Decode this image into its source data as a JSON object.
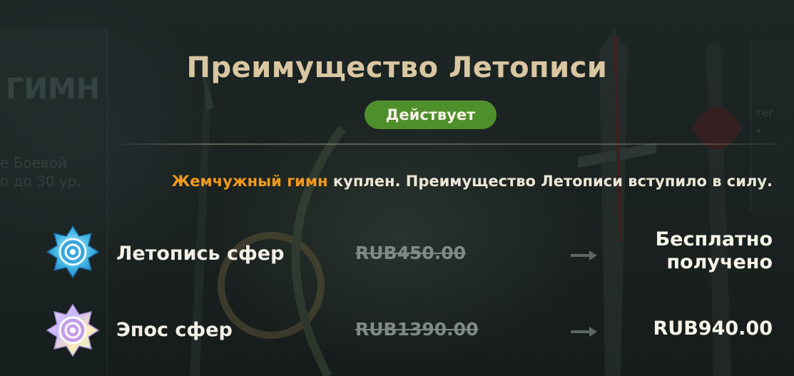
{
  "header": {
    "title": "Преимущество Летописи",
    "status_badge": "Действует"
  },
  "background": {
    "left_panel_title": "ГИМН",
    "left_panel_text_line1": "е Боевой",
    "left_panel_text_line2": "о до 30 ур.",
    "right_panel_text_line1": "тег",
    "right_panel_text_line2": "•"
  },
  "notice": {
    "highlight": "Жемчужный гимн",
    "rest": " куплен. Преимущество Летописи вступило в силу."
  },
  "rows": [
    {
      "name": "Летопись сфер",
      "old_price": "RUB450.00",
      "result_line1": "Бесплатно",
      "result_line2": "получено",
      "icon": "chronicle-orb-blue-icon"
    },
    {
      "name": "Эпос сфер",
      "old_price": "RUB1390.00",
      "result_line1": "RUB940.00",
      "icon": "epic-orb-iridescent-icon"
    }
  ],
  "colors": {
    "title": "#d9c7a2",
    "badge_bg": "#4f8f2b",
    "highlight": "#f29a1b",
    "text": "#ece6d6",
    "strikethrough": "#7f8a86"
  }
}
